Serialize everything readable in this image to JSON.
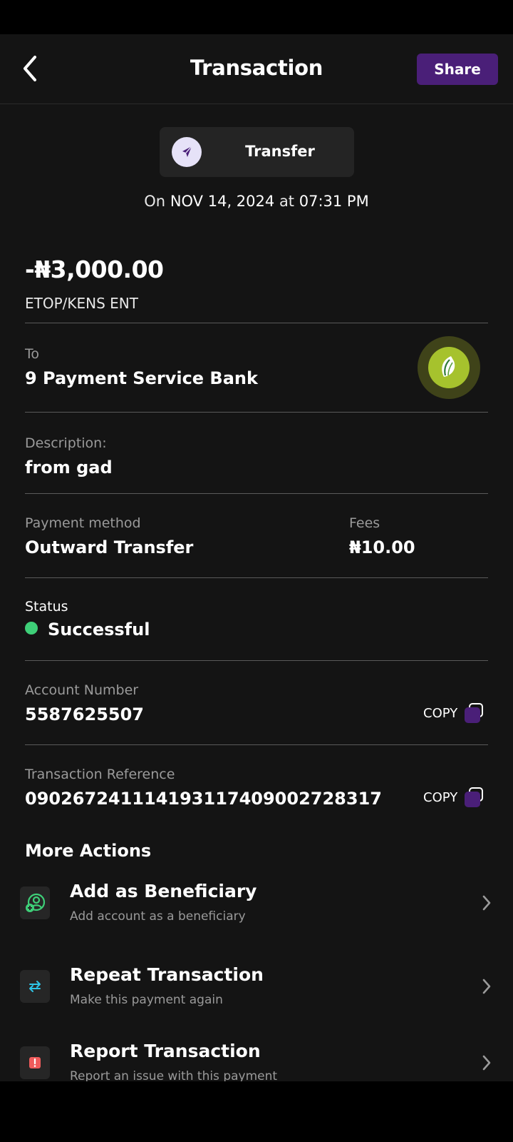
{
  "header": {
    "title": "Transaction",
    "share_label": "Share"
  },
  "transaction_type": {
    "label": "Transfer",
    "icon": "send-arrow-icon"
  },
  "date_line": {
    "prefix": "On",
    "date": "NOV 14, 2024",
    "joiner": "at",
    "time": "07:31 PM"
  },
  "amount": "-₦3,000.00",
  "counterparty": "ETOP/KENS ENT",
  "recipient": {
    "label": "To",
    "value": "9 Payment Service Bank",
    "logo_icon": "leaf-logo-icon"
  },
  "description": {
    "label": "Description:",
    "value": "from gad"
  },
  "payment_method": {
    "label": "Payment method",
    "value": "Outward Transfer"
  },
  "fees": {
    "label": "Fees",
    "value": "₦10.00"
  },
  "status": {
    "label": "Status",
    "value": "Successful",
    "color": "#3ecf78"
  },
  "account_number": {
    "label": "Account Number",
    "value": "5587625507",
    "copy_label": "COPY"
  },
  "transaction_reference": {
    "label": "Transaction Reference",
    "value": "090267241114193117409002728317",
    "copy_label": "COPY"
  },
  "more_actions": {
    "title": "More Actions",
    "items": [
      {
        "title": "Add as Beneficiary",
        "subtitle": "Add account as a beneficiary",
        "icon": "add-user-icon"
      },
      {
        "title": "Repeat Transaction",
        "subtitle": "Make this payment again",
        "icon": "repeat-icon"
      },
      {
        "title": "Report Transaction",
        "subtitle": "Report an issue with this payment",
        "icon": "alert-icon"
      }
    ]
  },
  "colors": {
    "accent": "#4a1f78",
    "background": "#141414",
    "success": "#3ecf78"
  }
}
